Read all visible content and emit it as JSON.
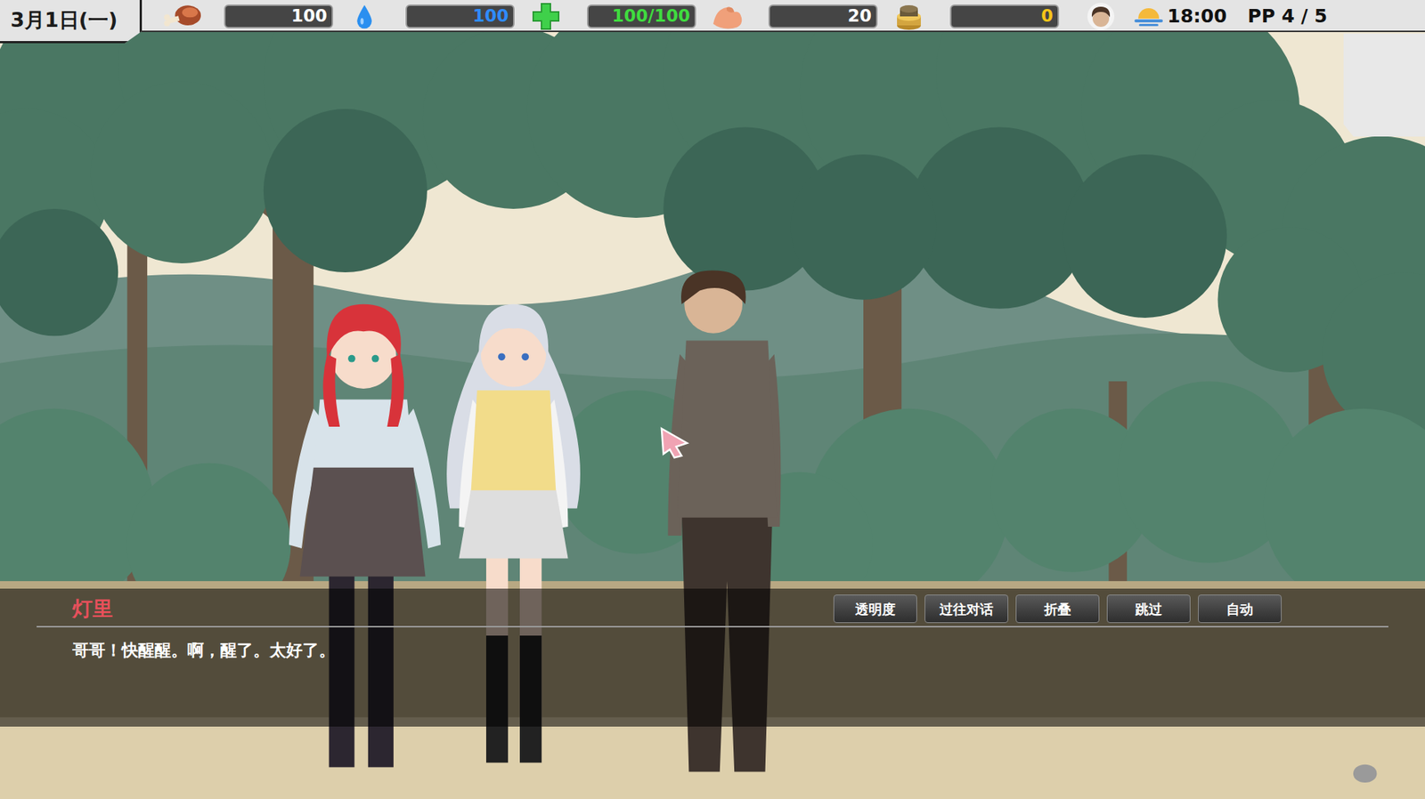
{
  "hud": {
    "date": "3月1日(一)",
    "stats": [
      {
        "kind": "food",
        "value": "100",
        "color": "#ffffff"
      },
      {
        "kind": "water",
        "value": "100",
        "color": "#2f8cff"
      },
      {
        "kind": "health",
        "value": "100/100",
        "color": "#3fdc3f"
      },
      {
        "kind": "strength",
        "value": "20",
        "color": "#ffffff"
      },
      {
        "kind": "money",
        "value": "0",
        "color": "#f5c518"
      }
    ],
    "time": "18:00",
    "pp": "PP 4 / 5"
  },
  "dialogue": {
    "speaker": "灯里",
    "text": "哥哥！快醒醒。啊，醒了。太好了。",
    "buttons": [
      "透明度",
      "过往对话",
      "折叠",
      "跳过",
      "自动"
    ]
  }
}
